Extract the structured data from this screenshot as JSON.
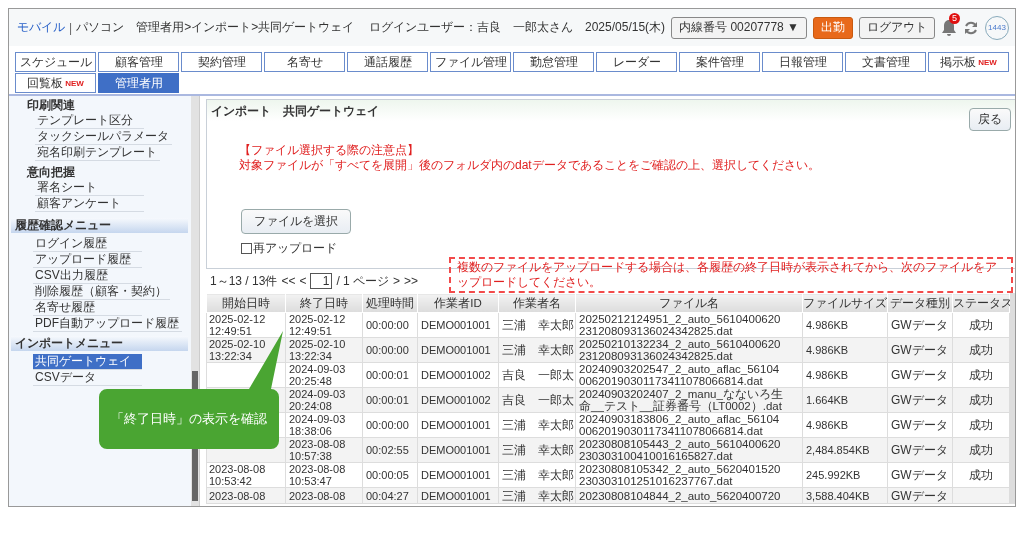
{
  "header": {
    "breadcrumb": {
      "mobile": "モバイル",
      "separator": "|",
      "pc": "パソコン",
      "path": "管理者用>インポート>共同ゲートウェイ"
    },
    "login": "ログインユーザー：吉良　一郎太さん　2025/05/15(木)",
    "extension": "内線番号 00207778 ▼",
    "clock_in": "出勤",
    "logout": "ログアウト",
    "notifications": "5",
    "avatar": "1443"
  },
  "tabs": [
    [
      {
        "label": "スケジュール",
        "selected": false
      },
      {
        "label": "顧客管理",
        "selected": false
      },
      {
        "label": "契約管理",
        "selected": false
      },
      {
        "label": "名寄せ",
        "selected": false
      },
      {
        "label": "通話履歴",
        "selected": false
      },
      {
        "label": "ファイル管理",
        "selected": false
      },
      {
        "label": "勤怠管理",
        "selected": false
      },
      {
        "label": "レーダー",
        "selected": false
      },
      {
        "label": "案件管理",
        "selected": false
      },
      {
        "label": "日報管理",
        "selected": false
      },
      {
        "label": "文書管理",
        "selected": false
      },
      {
        "label": "掲示板",
        "selected": false,
        "badge": "NEW"
      }
    ],
    [
      {
        "label": "回覧板",
        "selected": false,
        "badge": "NEW"
      },
      {
        "label": "管理者用",
        "selected": true
      }
    ]
  ],
  "sidebar": {
    "sections": [
      {
        "kind": "group",
        "title": "印刷関連",
        "items": [
          {
            "label": "テンプレート区分",
            "selected": false
          },
          {
            "label": "タックシールパラメータ",
            "selected": false
          },
          {
            "label": "宛名印刷テンプレート",
            "selected": false
          }
        ]
      },
      {
        "kind": "group",
        "title": "意向把握",
        "items": [
          {
            "label": "署名シート",
            "selected": false
          },
          {
            "label": "顧客アンケート",
            "selected": false
          }
        ]
      },
      {
        "kind": "menu",
        "title": "履歴確認メニュー",
        "items": [
          {
            "label": "ログイン履歴",
            "selected": false
          },
          {
            "label": "アップロード履歴",
            "selected": false
          },
          {
            "label": "CSV出力履歴",
            "selected": false
          },
          {
            "label": "削除履歴（顧客・契約）",
            "selected": false
          },
          {
            "label": "名寄せ履歴",
            "selected": false
          },
          {
            "label": "PDF自動アップロード履歴",
            "selected": false
          }
        ]
      },
      {
        "kind": "menu",
        "title": "インポートメニュー",
        "items": [
          {
            "label": "共同ゲートウェイ",
            "selected": true
          },
          {
            "label": "CSVデータ",
            "selected": false
          }
        ]
      }
    ]
  },
  "panel": {
    "title": "インポート　共同ゲートウェイ",
    "back": "戻る",
    "notice_title": "【ファイル選択する際の注意点】",
    "notice": "対象ファイルが「すべてを展開」後のフォルダ内のdatデータであることをご確認の上、選択してください。",
    "file_button": "ファイルを選択",
    "reupload": {
      "label": "再アップロード",
      "checked": false
    }
  },
  "pagination": {
    "range": "1～13 / 13件",
    "first": "<<",
    "prev": "<",
    "page": "1",
    "total": "/ 1 ページ",
    "next": ">",
    "last": ">>"
  },
  "note": "複数のファイルをアップロードする場合は、各履歴の終了日時が表示されてから、次のファイルをアップロードしてください。",
  "table": {
    "columns": [
      "開始日時",
      "終了日時",
      "処理時間",
      "作業者ID",
      "作業者名",
      "ファイル名",
      "ファイルサイズ",
      "データ種別",
      "ステータス"
    ],
    "rows": [
      {
        "start": "2025-02-12\n12:49:51",
        "end": "2025-02-12\n12:49:51",
        "duration": "00:00:00",
        "operator_id": "DEMO001001",
        "operator": "三浦　幸太郎",
        "file": [
          "20250212124951_2_auto_5610400620",
          "231208093136024342825.dat"
        ],
        "size": "4.986KB",
        "type": "GWデータ",
        "status": "成功"
      },
      {
        "start": "2025-02-10\n13:22:34",
        "end": "2025-02-10\n13:22:34",
        "duration": "00:00:00",
        "operator_id": "DEMO001001",
        "operator": "三浦　幸太郎",
        "file": [
          "20250210132234_2_auto_5610400620",
          "231208093136024342825.dat"
        ],
        "size": "4.986KB",
        "type": "GWデータ",
        "status": "成功"
      },
      {
        "end": "2024-09-03\n20:25:48",
        "duration": "00:00:01",
        "operator_id": "DEMO001002",
        "operator": "吉良　一郎太",
        "file": [
          "20240903202547_2_auto_aflac_56104",
          "00620190301173411078066814.dat"
        ],
        "size": "4.986KB",
        "type": "GWデータ",
        "status": "成功"
      },
      {
        "end": "2024-09-03\n20:24:08",
        "duration": "00:00:01",
        "operator_id": "DEMO001002",
        "operator": "吉良　一郎太",
        "file": [
          "20240903202407_2_manu_なないろ生",
          "命__テスト__証券番号（LT0002）.dat"
        ],
        "size": "1.664KB",
        "type": "GWデータ",
        "status": "成功"
      },
      {
        "end": "2024-09-03\n18:38:06",
        "duration": "00:00:00",
        "operator_id": "DEMO001001",
        "operator": "三浦　幸太郎",
        "file": [
          "20240903183806_2_auto_aflac_56104",
          "00620190301173411078066814.dat"
        ],
        "size": "4.986KB",
        "type": "GWデータ",
        "status": "成功"
      },
      {
        "end": "2023-08-08\n10:57:38",
        "duration": "00:02:55",
        "operator_id": "DEMO001001",
        "operator": "三浦　幸太郎",
        "file": [
          "20230808105443_2_auto_5610400620",
          "230303100410016165827.dat"
        ],
        "size": "2,484.854KB",
        "type": "GWデータ",
        "status": "成功"
      },
      {
        "start": "2023-08-08\n10:53:42",
        "end": "2023-08-08\n10:53:47",
        "duration": "00:00:05",
        "operator_id": "DEMO001001",
        "operator": "三浦　幸太郎",
        "file": [
          "20230808105342_2_auto_5620401520",
          "230303101251016237767.dat"
        ],
        "size": "245.992KB",
        "type": "GWデータ",
        "status": "成功"
      },
      {
        "start": "2023-08-08",
        "end": "2023-08-08",
        "duration": "00:04:27",
        "operator_id": "DEMO001001",
        "operator": "三浦　幸太郎",
        "file": [
          "20230808104844_2_auto_5620400720"
        ],
        "size": "3,588.404KB",
        "type": "GWデータ"
      }
    ]
  },
  "callout": "「終了日時」の表示を確認"
}
